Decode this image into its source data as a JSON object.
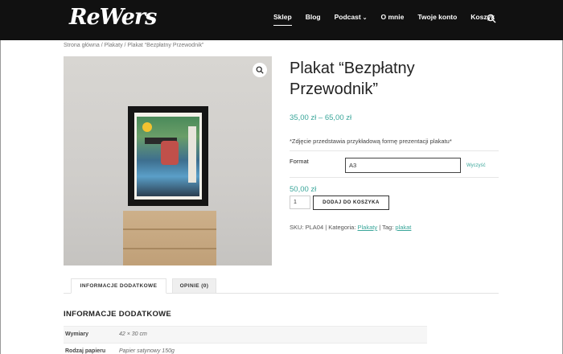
{
  "header": {
    "logo": "ReWers",
    "nav": [
      {
        "label": "Sklep",
        "active": true
      },
      {
        "label": "Blog"
      },
      {
        "label": "Podcast",
        "has_dropdown": true
      },
      {
        "label": "O mnie"
      },
      {
        "label": "Twoje konto"
      },
      {
        "label": "Koszyk"
      }
    ],
    "search_icon": "search-icon"
  },
  "breadcrumb": {
    "home": "Strona główna",
    "sep1": " / ",
    "category": "Plakaty",
    "sep2": " / ",
    "current": "Plakat “Bezpłatny Przewodnik”"
  },
  "product": {
    "zoom_icon": "magnifier-icon",
    "title": "Plakat “Bezpłatny Przewodnik”",
    "price_range": "35,00 zł – 65,00 zł",
    "note": "*Zdjęcie przedstawia przykładową formę prezentacji plakatu*",
    "format_label": "Format",
    "format_value": "A3",
    "reset_label": "Wyczyść",
    "variant_price": "50,00 zł",
    "quantity": "1",
    "add_to_cart": "DODAJ DO KOSZYKA",
    "meta": {
      "sku_label": "SKU: ",
      "sku": "PLA04",
      "category_label": " | Kategoria: ",
      "category": "Plakaty",
      "tag_label": " | Tag: ",
      "tag": "plakat"
    }
  },
  "tabs": [
    {
      "label": "INFORMACJE DODATKOWE",
      "active": true
    },
    {
      "label": "OPINIE (0)"
    }
  ],
  "additional_info": {
    "heading": "INFORMACJE DODATKOWE",
    "rows": [
      {
        "name": "Wymiary",
        "value": "42 × 30 cm"
      },
      {
        "name": "Rodzaj papieru",
        "value": "Papier satynowy 150g"
      }
    ]
  },
  "colors": {
    "header_bg": "#111111",
    "accent": "#3aa69a",
    "text": "#222222"
  }
}
